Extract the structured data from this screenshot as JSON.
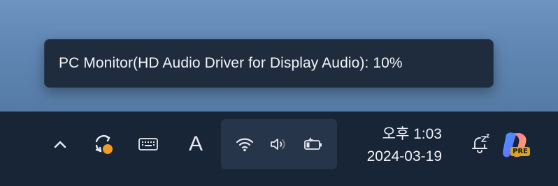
{
  "tooltip": {
    "text": "PC Monitor(HD Audio Driver for Display Audio): 10%"
  },
  "taskbar": {
    "ime_label": "A",
    "clock": {
      "time": "오후 1:03",
      "date": "2024-03-19"
    },
    "copilot_badge": "PRE"
  },
  "icons": {
    "chevron": "chevron-up-icon",
    "sync": "sync-status-icon",
    "keyboard": "touch-keyboard-icon",
    "wifi": "wifi-icon",
    "volume": "volume-icon",
    "battery": "battery-icon",
    "notifications": "notification-bell-sleep-icon",
    "copilot": "copilot-preview-icon"
  },
  "colors": {
    "taskbar_bg": "#182537",
    "tooltip_bg": "#1e2c3d",
    "sync_dot": "#f59a23",
    "pre_badge": "#d8a41a"
  }
}
